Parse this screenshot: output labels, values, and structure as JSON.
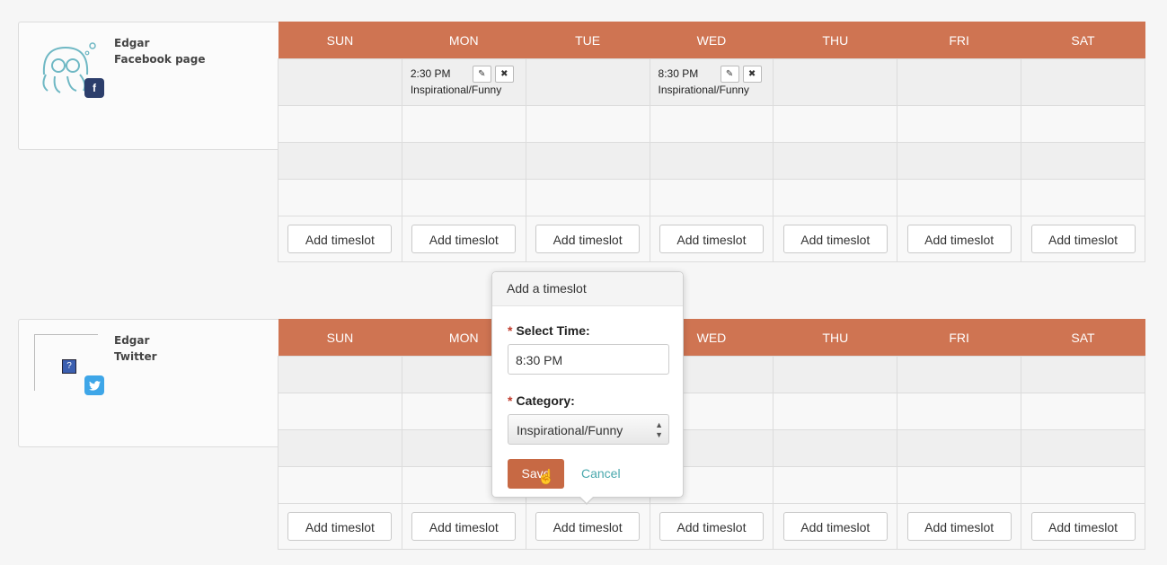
{
  "days": [
    "SUN",
    "MON",
    "TUE",
    "WED",
    "THU",
    "FRI",
    "SAT"
  ],
  "add_timeslot_label": "Add timeslot",
  "accounts": [
    {
      "name_line1": "Edgar",
      "name_line2": "Facebook page",
      "network_icon": "facebook-icon",
      "entries": {
        "MON": {
          "time": "2:30 PM",
          "category": "Inspirational/Funny"
        },
        "WED": {
          "time": "8:30 PM",
          "category": "Inspirational/Funny"
        }
      }
    },
    {
      "name_line1": "Edgar",
      "name_line2": "Twitter",
      "network_icon": "twitter-icon",
      "entries": {}
    }
  ],
  "popover": {
    "title": "Add a timeslot",
    "time_label": "Select Time:",
    "time_value": "8:30 PM",
    "category_label": "Category:",
    "category_value": "Inspirational/Funny",
    "save_label": "Save",
    "cancel_label": "Cancel",
    "required_mark": "*"
  },
  "colors": {
    "header": "#cf7452",
    "save": "#c76944",
    "cancel": "#4aa8ad",
    "facebook": "#2c3e6b",
    "twitter": "#3ea6e8"
  }
}
